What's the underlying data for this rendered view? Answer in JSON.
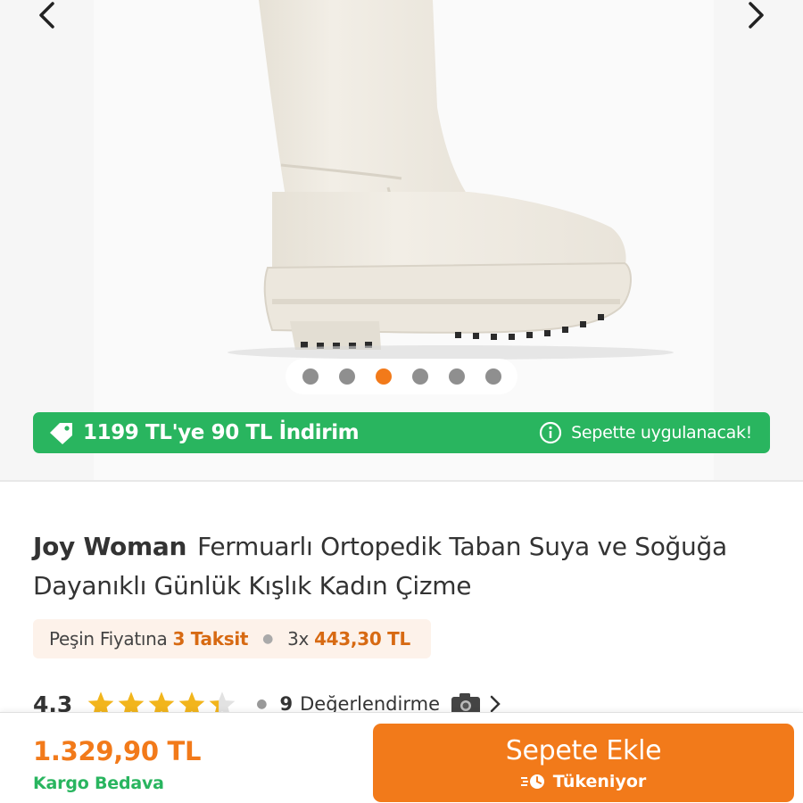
{
  "product": {
    "brand": "Joy Woman",
    "name": "Fermuarlı Ortopedik Taban Suya ve Soğuğa Dayanıklı Günlük Kışlık Kadın Çizme"
  },
  "gallery": {
    "image_count": 6,
    "active_index": 2
  },
  "promo": {
    "text": "1199 TL'ye 90 TL İndirim",
    "info": "Sepette uygulanacak!"
  },
  "installment": {
    "label": "Peşin Fiyatına",
    "highlight": "3 Taksit",
    "multiplier": "3x",
    "amount": "443,30 TL"
  },
  "rating": {
    "score": "4.3",
    "stars": 4.3,
    "count": "9",
    "label": "Değerlendirme"
  },
  "bottom_bar": {
    "price": "1.329,90 TL",
    "shipping": "Kargo Bedava",
    "add_to_cart": "Sepete Ekle",
    "stock_status": "Tükeniyor"
  },
  "colors": {
    "accent": "#f27a1a",
    "promo_green": "#29b55f",
    "star": "#f2b51c"
  }
}
